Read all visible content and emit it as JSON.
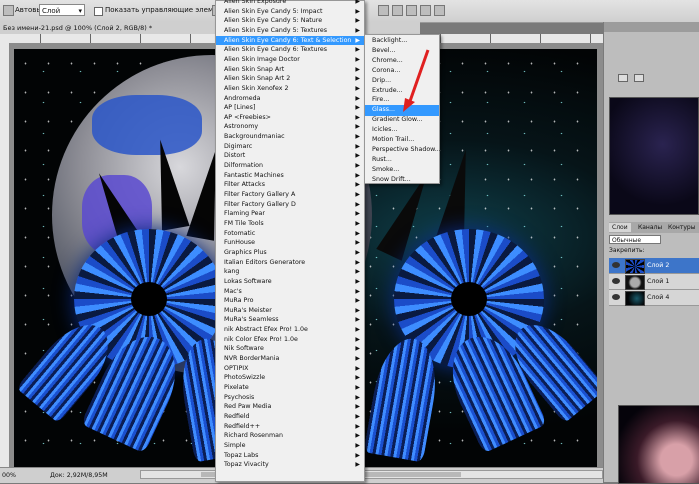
{
  "options_bar": {
    "autoselect_label": "Автовыбор:",
    "autoselect_value": "Слой",
    "show_controls_label": "Показать управляющие элементы"
  },
  "document_tab": {
    "title": "Без имени-21.psd @ 100% (Слой 2, RGB/8) *"
  },
  "filter_menu": {
    "items": [
      {
        "label": "Alien Skin Exposure",
        "submenu": true
      },
      {
        "label": "Alien Skin Eye Candy 5: Impact",
        "submenu": true
      },
      {
        "label": "Alien Skin Eye Candy 5: Nature",
        "submenu": true
      },
      {
        "label": "Alien Skin Eye Candy 5: Textures",
        "submenu": true
      },
      {
        "label": "Alien Skin Eye Candy 6: Text & Selection",
        "submenu": true,
        "highlighted": true
      },
      {
        "label": "Alien Skin Eye Candy 6: Textures",
        "submenu": true
      },
      {
        "label": "Alien Skin Image Doctor",
        "submenu": true
      },
      {
        "label": "Alien Skin Snap Art",
        "submenu": true
      },
      {
        "label": "Alien Skin Snap Art 2",
        "submenu": true
      },
      {
        "label": "Alien Skin Xenofex 2",
        "submenu": true
      },
      {
        "label": "Andromeda",
        "submenu": true
      },
      {
        "label": "AP [Lines]",
        "submenu": true
      },
      {
        "label": "AP <Freebies>",
        "submenu": true
      },
      {
        "label": "Astronomy",
        "submenu": true
      },
      {
        "label": "Backgroundmaniac",
        "submenu": true
      },
      {
        "label": "Digimarc",
        "submenu": true
      },
      {
        "label": "Distort",
        "submenu": true
      },
      {
        "label": "Dilformation",
        "submenu": true
      },
      {
        "label": "Fantastic Machines",
        "submenu": true
      },
      {
        "label": "Filter Attacks",
        "submenu": true
      },
      {
        "label": "Filter Factory Gallery A",
        "submenu": true
      },
      {
        "label": "Filter Factory Gallery D",
        "submenu": true
      },
      {
        "label": "Flaming Pear",
        "submenu": true
      },
      {
        "label": "FM Tile Tools",
        "submenu": true
      },
      {
        "label": "Fotomatic",
        "submenu": true
      },
      {
        "label": "FunHouse",
        "submenu": true
      },
      {
        "label": "Graphics Plus",
        "submenu": true
      },
      {
        "label": "Italian Editors Generatore",
        "submenu": true
      },
      {
        "label": "kang",
        "submenu": true
      },
      {
        "label": "Lokas Software",
        "submenu": true
      },
      {
        "label": "Mac's",
        "submenu": true
      },
      {
        "label": "MuRa Pro",
        "submenu": true
      },
      {
        "label": "MuRa's Meister",
        "submenu": true
      },
      {
        "label": "MuRa's Seamless",
        "submenu": true
      },
      {
        "label": "nik Abstract Efex Pro! 1.0e",
        "submenu": true
      },
      {
        "label": "nik Color Efex Pro! 1.0e",
        "submenu": true
      },
      {
        "label": "Nik Software",
        "submenu": true
      },
      {
        "label": "NVR BorderMania",
        "submenu": true
      },
      {
        "label": "OPTIPIX",
        "submenu": true
      },
      {
        "label": "PhotoSwizzle",
        "submenu": true
      },
      {
        "label": "Pixelate",
        "submenu": true
      },
      {
        "label": "Psychosis",
        "submenu": true
      },
      {
        "label": "Red Paw Media",
        "submenu": true
      },
      {
        "label": "Redfield",
        "submenu": true
      },
      {
        "label": "Redfield++",
        "submenu": true
      },
      {
        "label": "Richard Rosenman",
        "submenu": true
      },
      {
        "label": "Simple",
        "submenu": true
      },
      {
        "label": "Topaz Labs",
        "submenu": true
      },
      {
        "label": "Topaz Vivacity",
        "submenu": true
      }
    ]
  },
  "submenu": {
    "items": [
      {
        "label": "Backlight..."
      },
      {
        "label": "Bevel..."
      },
      {
        "label": "Chrome..."
      },
      {
        "label": "Corona..."
      },
      {
        "label": "Drip..."
      },
      {
        "label": "Extrude..."
      },
      {
        "label": "Fire..."
      },
      {
        "label": "Glass...",
        "highlighted": true
      },
      {
        "label": "Gradient Glow..."
      },
      {
        "label": "Icicles..."
      },
      {
        "label": "Motion Trail..."
      },
      {
        "label": "Perspective Shadow..."
      },
      {
        "label": "Rust..."
      },
      {
        "label": "Smoke..."
      },
      {
        "label": "Snow Drift..."
      }
    ]
  },
  "layers_panel": {
    "tabs": [
      "Слои",
      "Каналы",
      "Контуры"
    ],
    "blend_mode": "Обычные",
    "lock_label": "Закрепить:",
    "layers": [
      {
        "name": "Слой 2",
        "active": true
      },
      {
        "name": "Слой 1",
        "active": false
      },
      {
        "name": "Слой 4",
        "active": false
      }
    ]
  },
  "status_bar": {
    "zoom": "00%",
    "doc_size": "Док: 2,92M/8,95M"
  },
  "colors": {
    "menu_highlight": "#3399ff",
    "layer_selected": "#3d75c9",
    "annotation_arrow": "#e02020"
  }
}
